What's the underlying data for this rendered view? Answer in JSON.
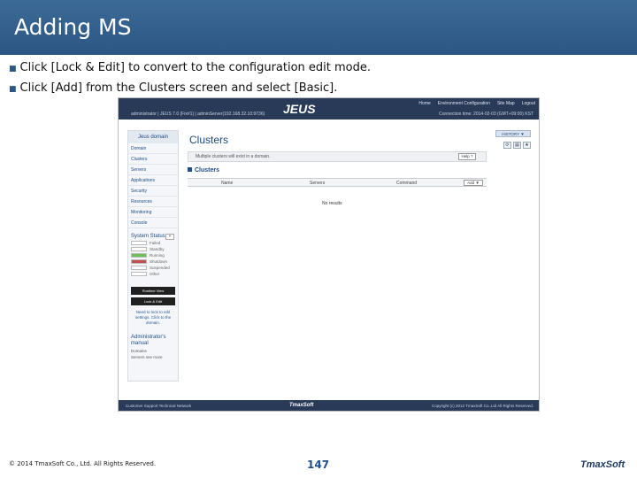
{
  "slide": {
    "title": "Adding MS",
    "bullets": [
      "Click [Lock & Edit] to convert to the configuration edit mode.",
      "Click [Add] from the Clusters screen and select [Basic]."
    ],
    "copyright": "© 2014 TmaxSoft Co., Ltd. All Rights Reserved.",
    "page_number": "147",
    "brand": "TmaxSoft"
  },
  "screenshot": {
    "logo": "JEUS",
    "top_nav": [
      "Home",
      "Environment Configuration",
      "Site Map",
      "Logout"
    ],
    "user_info": "administrator | JEUS 7.0 (Fix#1) | adminServer(192.168.32.10:9736)",
    "connection_info": "Connection time: 2014-02-03 (GMT+09:00) KST",
    "sidebar": {
      "header": "Jeus domain",
      "items": [
        "Domain",
        "Clusters",
        "Servers",
        "Applications",
        "Security",
        "Resources",
        "Monitoring",
        "Console"
      ],
      "system_status_title": "System Status",
      "statuses": [
        {
          "label": "Failed",
          "color": "#ffffff"
        },
        {
          "label": "Standby",
          "color": "#ffffff"
        },
        {
          "label": "Running",
          "color": "#6fbf5a"
        },
        {
          "label": "Shutdown",
          "color": "#c0504d"
        },
        {
          "label": "Suspended",
          "color": "#ffffff"
        },
        {
          "label": "Other",
          "color": "#ffffff"
        }
      ],
      "runtime_mode_button": "Runtime View",
      "lock_edit_button": "Lock & Edit",
      "mode_note": "Need to lock to edit settings. Click to the domain.",
      "manual_title": "Administrator's manual",
      "manual_items": [
        "Domains",
        "Servers    see more"
      ]
    },
    "main": {
      "page_title": "Clusters",
      "history_button": "HISTORY ▼",
      "info_message": "Multiple clusters will exist in a domain.",
      "help_button": "Help ?",
      "section_title": "Clusters",
      "columns": [
        "Name",
        "Servers",
        "Command"
      ],
      "add_button": "Add ▼",
      "empty_message": "No results"
    },
    "footer": {
      "left": "Customer Support    Technical Network",
      "center": "TmaxSoft",
      "right": "Copyright (c) 2012 TmaxSoft Co.,Ltd All Rights Reserved."
    }
  }
}
